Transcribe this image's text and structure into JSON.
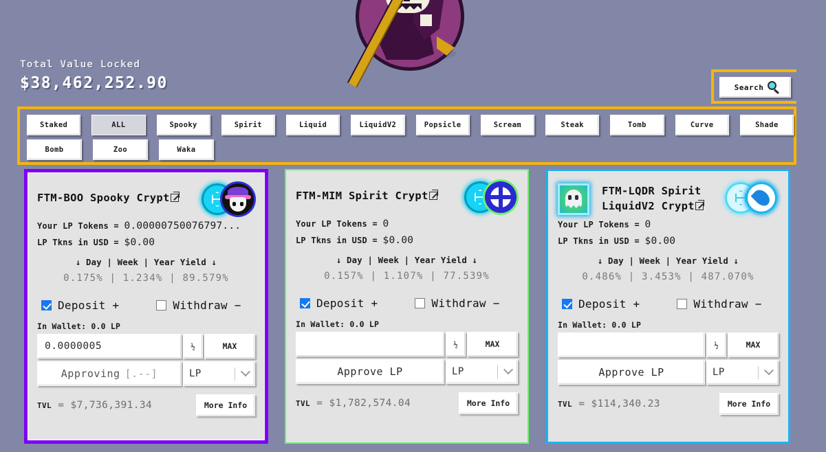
{
  "header": {
    "tvl_label": "Total Value Locked",
    "tvl_value": "$38,462,252.90",
    "logo_name": "grim-reaper-logo"
  },
  "search": {
    "label": "Search",
    "icon": "magnifying-glass-icon"
  },
  "filters": {
    "row1": [
      "Staked",
      "ALL",
      "Spooky",
      "Spirit",
      "Liquid",
      "LiquidV2",
      "Popsicle",
      "Scream",
      "Steak",
      "Tomb",
      "Curve",
      "Shade"
    ],
    "row2": [
      "Bomb",
      "Zoo",
      "Waka"
    ],
    "active": "ALL"
  },
  "labels": {
    "lp_tokens": "Your LP Tokens =",
    "lp_usd": "LP Tkns in USD =",
    "yield_header": "↓ Day | Week | Year Yield ↓",
    "deposit": "Deposit +",
    "withdraw": "Withdraw −",
    "in_wallet": "In Wallet: 0.0 LP",
    "half": "½",
    "max": "MAX",
    "tvl_key": "TVL",
    "tvl_eq": " = ",
    "more_info": "More Info"
  },
  "cards": [
    {
      "title": "FTM-BOO Spooky Crypt",
      "border_color": "#7d00f5",
      "icons_left": null,
      "icons_right": [
        "ftm-token-icon",
        "boo-token-icon"
      ],
      "lp_tokens": "0.00000750076797...",
      "lp_usd": "$0.00",
      "yield_day": "0.175%",
      "yield_week": "1.234%",
      "yield_year": "89.579%",
      "yield_line": "0.175% | 1.234% | 89.579%",
      "deposit_checked": true,
      "withdraw_checked": false,
      "in_wallet": "In Wallet: 0.0 LP",
      "amount_value": "0.0000005",
      "amount_placeholder": "",
      "action_label": "Approving",
      "action_suffix": "[.--]",
      "token_select": "LP",
      "tvl": "$7,736,391.34",
      "more_info": "More Info"
    },
    {
      "title": "FTM-MIM Spirit Crypt",
      "border_color": "#6ef06e",
      "icons_left": null,
      "icons_right": [
        "ftm-token-icon",
        "mim-token-icon"
      ],
      "lp_tokens": "0",
      "lp_usd": "$0.00",
      "yield_day": "0.157%",
      "yield_week": "1.107%",
      "yield_year": "77.539%",
      "yield_line": "0.157% | 1.107% | 77.539%",
      "deposit_checked": true,
      "withdraw_checked": false,
      "in_wallet": "In Wallet: 0.0 LP",
      "amount_value": "",
      "amount_placeholder": "",
      "action_label": "Approve LP",
      "action_suffix": "",
      "token_select": "LP",
      "tvl": "$1,782,574.04",
      "more_info": "More Info"
    },
    {
      "title": "FTM-LQDR Spirit LiquidV2 Crypt",
      "border_color": "#19b4f0",
      "icons_left": "spirit-ghost-icon",
      "icons_right": [
        "ftm-token-icon",
        "lqdr-token-icon"
      ],
      "lp_tokens": "0",
      "lp_usd": "$0.00",
      "yield_day": "0.486%",
      "yield_week": "3.453%",
      "yield_year": "487.070%",
      "yield_line": "0.486% | 3.453% | 487.070%",
      "deposit_checked": true,
      "withdraw_checked": false,
      "in_wallet": "In Wallet: 0.0 LP",
      "amount_value": "",
      "amount_placeholder": "",
      "action_label": "Approve LP",
      "action_suffix": "",
      "token_select": "LP",
      "tvl": "$114,340.23",
      "more_info": "More Info"
    }
  ],
  "colors": {
    "page_bg": "#8287a8",
    "accent_yellow": "#f5b50a",
    "card_bg": "#e3e3e3",
    "checkbox_blue": "#1877f2"
  }
}
